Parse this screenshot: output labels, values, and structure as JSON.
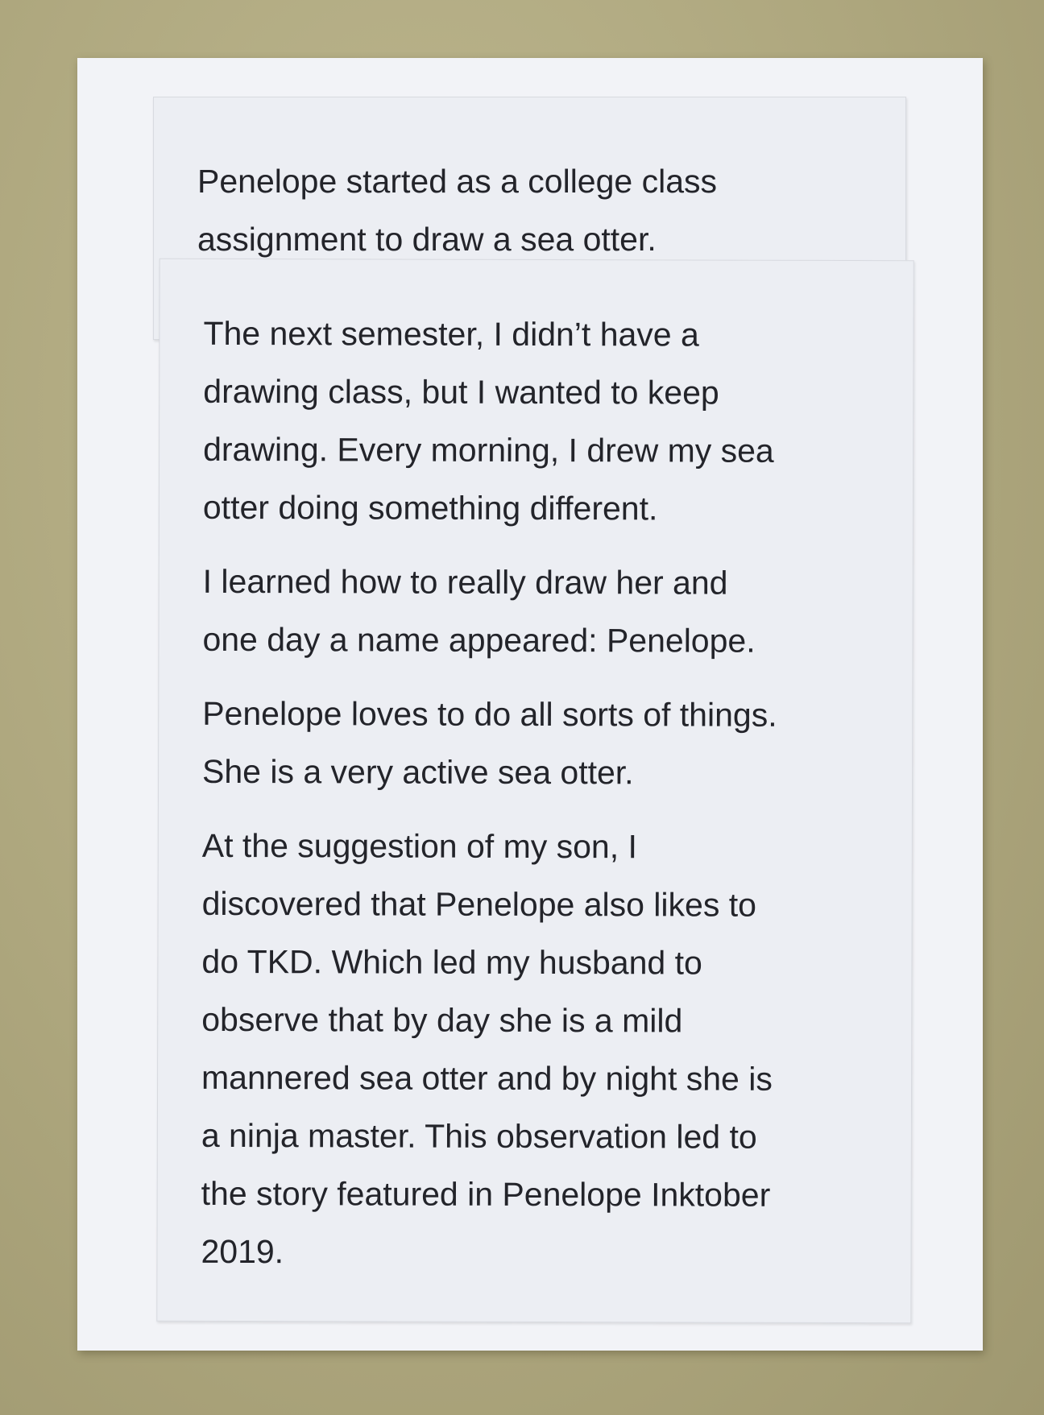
{
  "top_card": {
    "text": "Penelope started as a college class\nassignment to draw a sea otter."
  },
  "main_card": {
    "paragraphs": [
      "The next semester, I didn’t have a\ndrawing class, but I wanted to keep\ndrawing.  Every morning, I drew my sea\notter doing something different.",
      "I learned how to really draw her and\none day a name appeared: Penelope.",
      "Penelope loves to do all sorts of things.\nShe is a very active sea otter.",
      "At the suggestion of my son, I\ndiscovered that Penelope also likes to\ndo TKD. Which led my husband to\nobserve that by day she is a mild\nmannered sea otter and by night she is\na ninja master. This observation led to\nthe story featured in Penelope Inktober\n2019."
    ]
  }
}
